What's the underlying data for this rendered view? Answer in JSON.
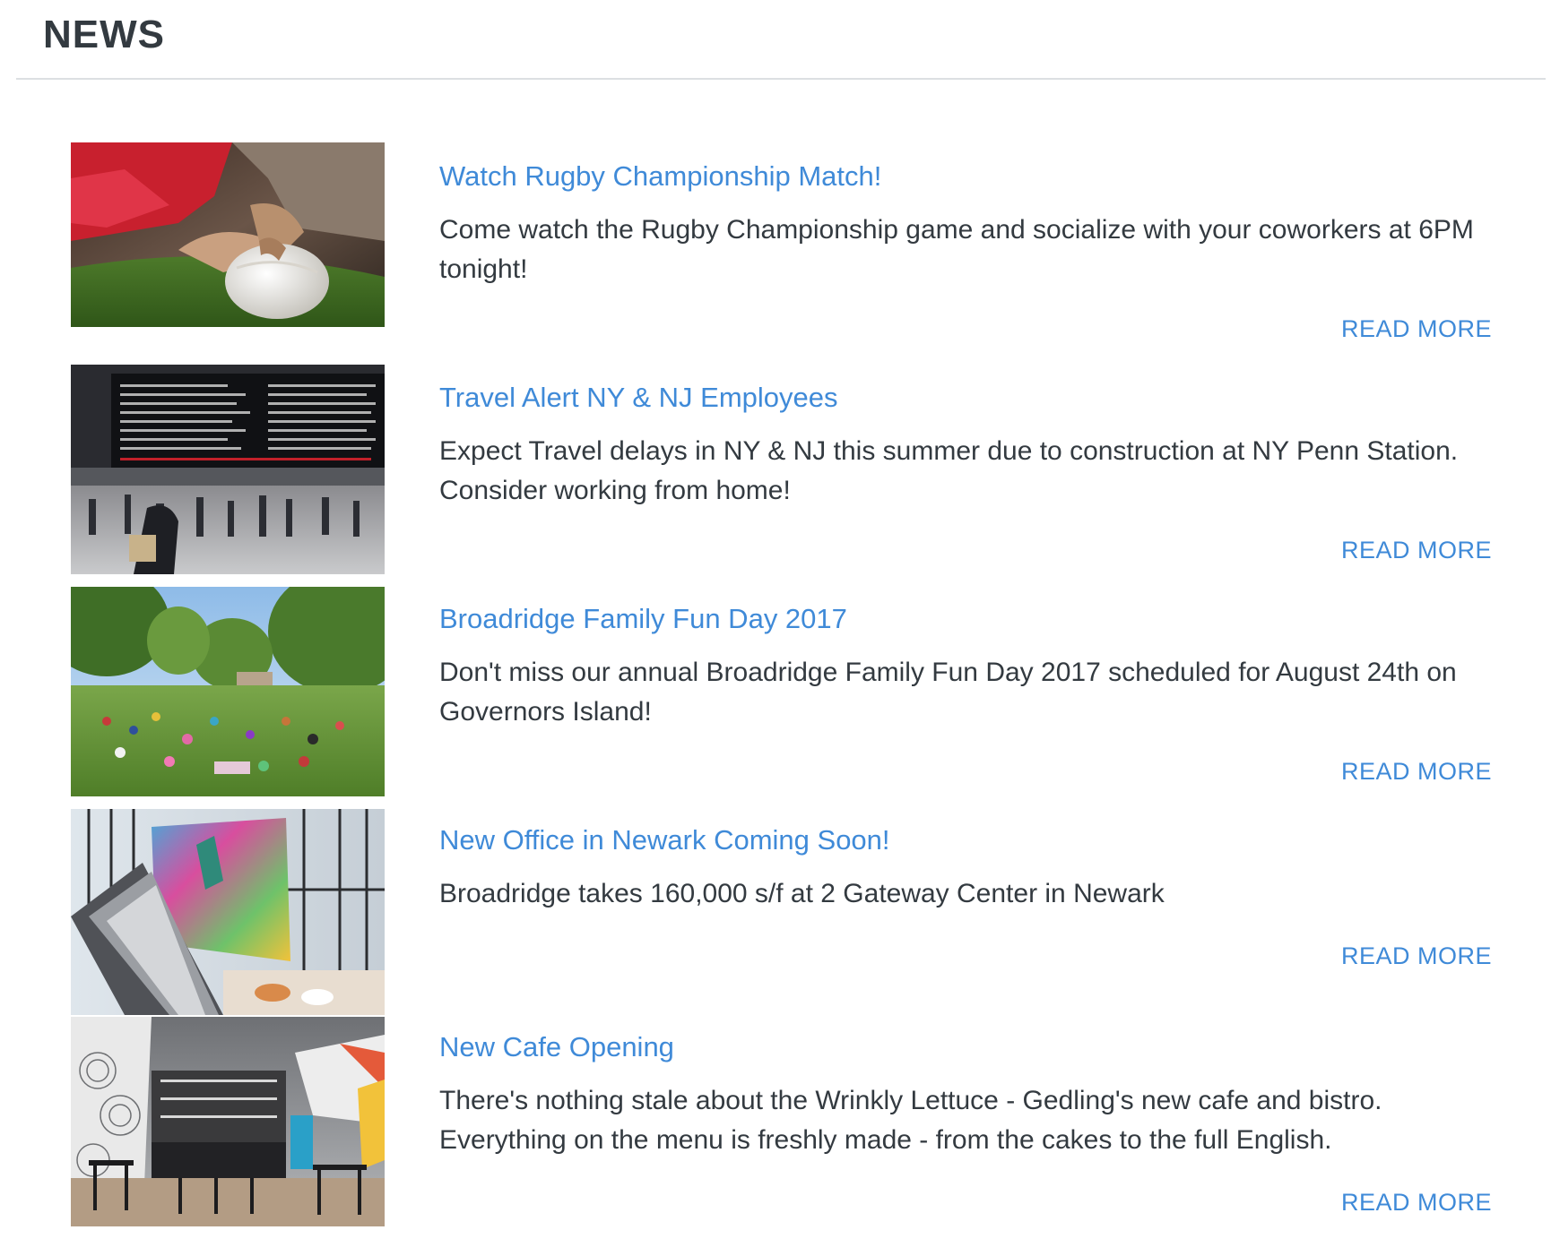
{
  "header": {
    "title": "NEWS"
  },
  "colors": {
    "link": "#3f8ad8",
    "text": "#333a40",
    "divider": "#dcdfe2"
  },
  "news": [
    {
      "title": "Watch Rugby Championship Match!",
      "body": "Come watch the Rugby Championship game and socialize with your coworkers at 6PM tonight!",
      "read_more": "READ MORE",
      "image": "rugby-player-grounding-ball-photo"
    },
    {
      "title": "Travel Alert NY & NJ Employees",
      "body": "Expect Travel delays in NY & NJ this summer due to construction at NY Penn Station. Consider working from home!",
      "read_more": "READ MORE",
      "image": "train-station-departures-board-photo"
    },
    {
      "title": "Broadridge Family Fun Day 2017",
      "body": "Don't miss our annual Broadridge Family Fun Day 2017 scheduled for August 24th on Governors Island!",
      "read_more": "READ MORE",
      "image": "park-picnic-crowd-photo"
    },
    {
      "title": "New Office in Newark Coming Soon!",
      "body": "Broadridge takes 160,000 s/f at 2 Gateway Center in Newark",
      "read_more": "READ MORE",
      "image": "office-lobby-escalator-mural-photo"
    },
    {
      "title": "New Cafe Opening",
      "body": "There's nothing stale about the Wrinkly Lettuce - Gedling's new cafe and bistro. Everything on the menu is freshly made - from the cakes to the full English.",
      "read_more": "READ MORE",
      "image": "cafe-bar-interior-photo"
    }
  ]
}
